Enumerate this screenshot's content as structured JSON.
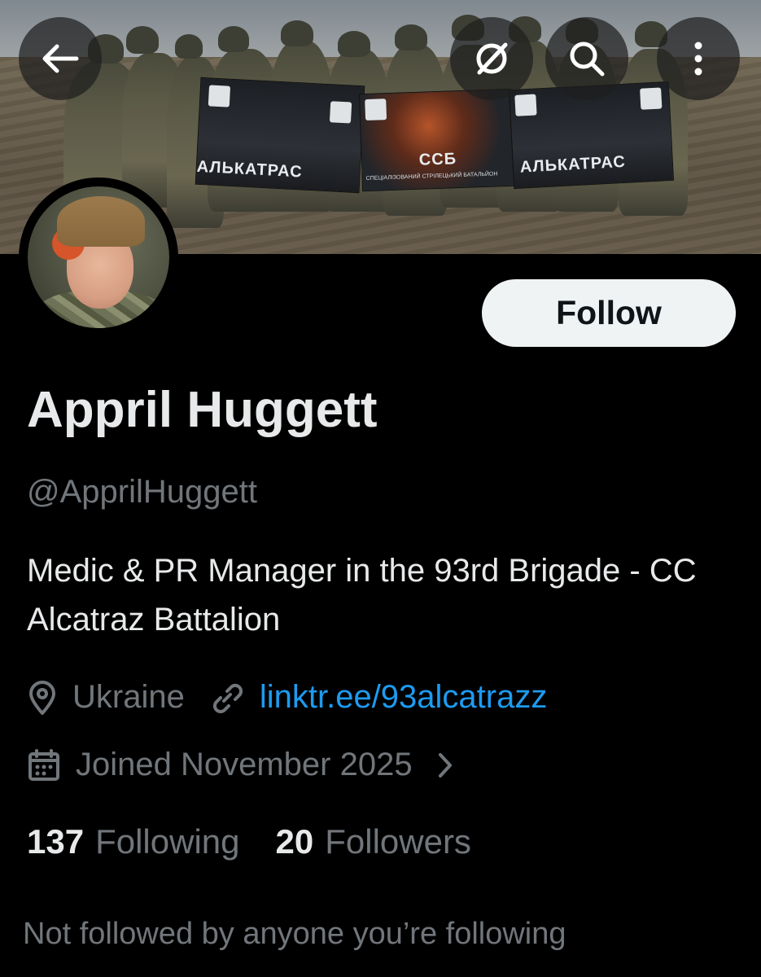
{
  "banner": {
    "flag_left_text": "АЛЬКАТРАС",
    "flag_mid_text": "ССБ",
    "flag_mid_subtext": "СПЕЦІАЛІЗОВАНИЙ СТРІЛЕЦЬКИЙ БАТАЛЬЙОН",
    "flag_right_text": "АЛЬКАТРАС"
  },
  "header": {
    "back_icon": "arrow-left-icon",
    "grok_icon": "grok-icon",
    "search_icon": "search-icon",
    "more_icon": "more-vertical-icon"
  },
  "profile": {
    "name": "Appril Huggett",
    "handle": "@ApprilHuggett",
    "bio": "Medic & PR Manager in the 93rd Brigade - CC Alcatraz Battalion",
    "location": "Ukraine",
    "link": "linktr.ee/93alcatrazz",
    "joined": "Joined November 2025"
  },
  "actions": {
    "follow_label": "Follow"
  },
  "stats": {
    "following_count": "137",
    "following_label": "Following",
    "followers_count": "20",
    "followers_label": "Followers"
  },
  "social_context": "Not followed by anyone you’re following",
  "colors": {
    "background": "#000000",
    "text_primary": "#e7e9ea",
    "text_secondary": "#71767b",
    "link": "#1d9bf0",
    "follow_button": "#eff3f4"
  }
}
